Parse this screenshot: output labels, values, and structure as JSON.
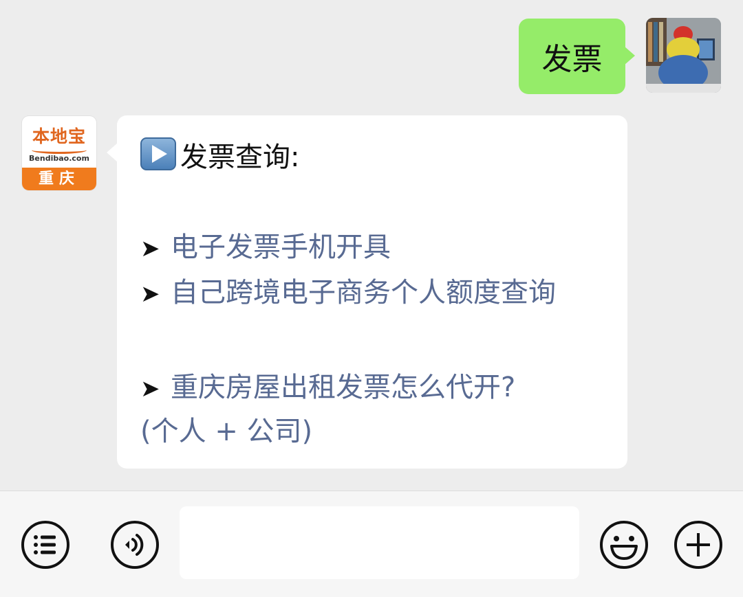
{
  "outgoing": {
    "text": "发票"
  },
  "bot": {
    "avatar": {
      "brand": "本地宝",
      "domain": "Bendibao.com",
      "city": "重庆"
    },
    "title": "发票查询:",
    "links": [
      "电子发票手机开具",
      "自己跨境电子商务个人额度查询",
      "重庆房屋出租发票怎么代开?"
    ],
    "continuation": "(个人 + 公司)",
    "arrow_glyph": "➤"
  },
  "input": {
    "value": "",
    "placeholder": ""
  },
  "icons": [
    "menu-icon",
    "voice-icon",
    "emoji-icon",
    "plus-icon",
    "play-icon"
  ],
  "colors": {
    "bubble_out": "#95ec69",
    "link": "#586a92",
    "accent": "#f07b1d"
  }
}
